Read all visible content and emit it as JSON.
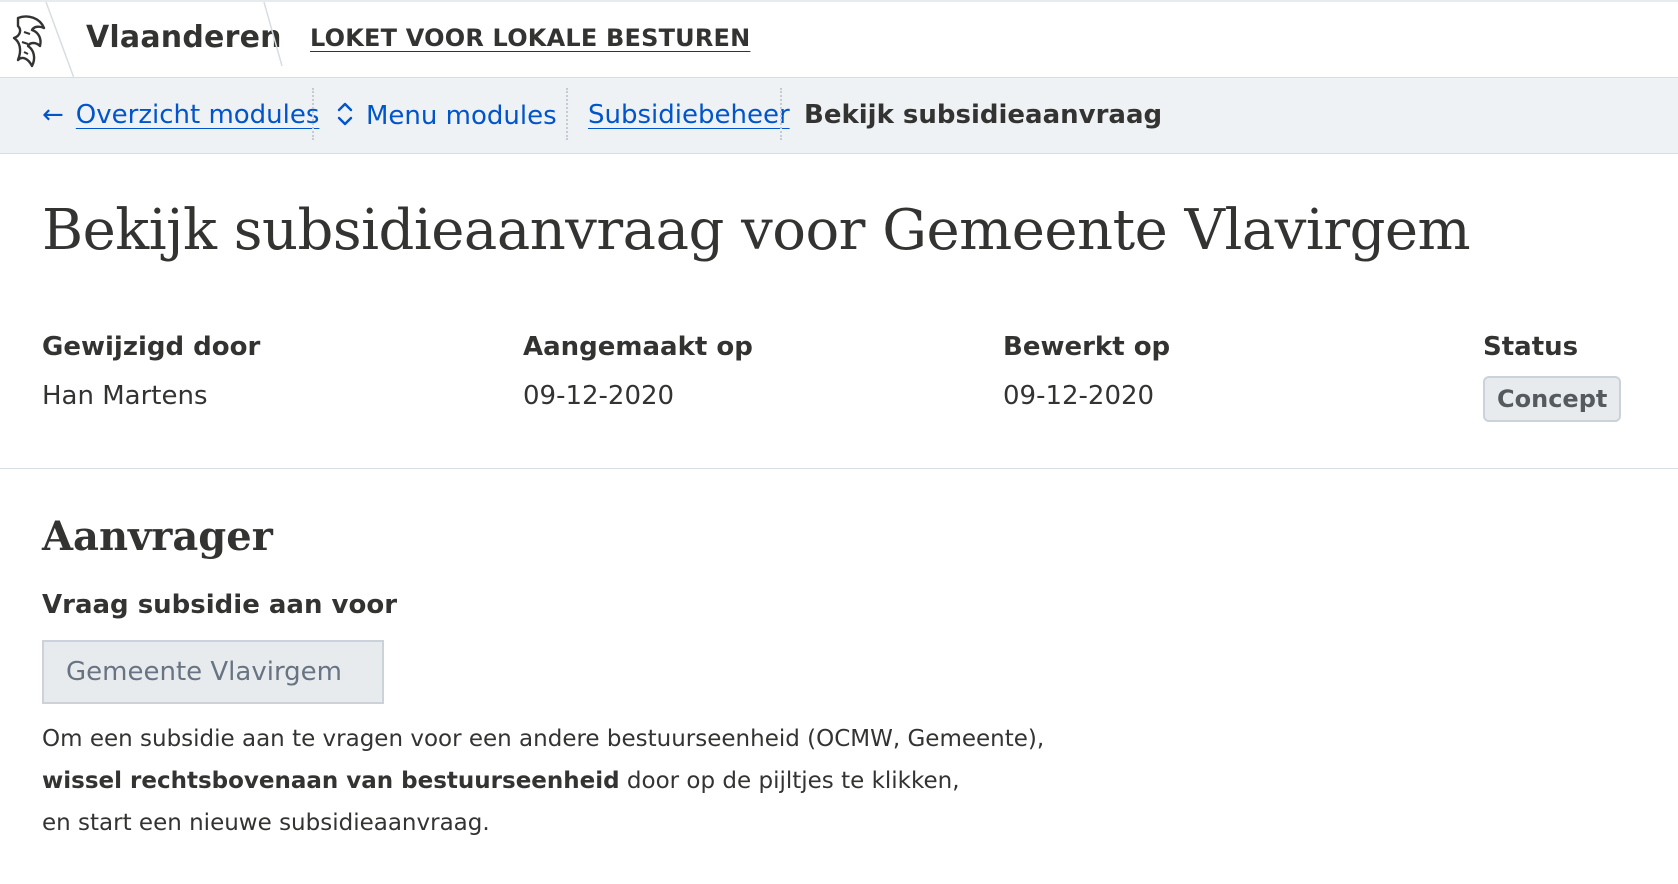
{
  "header": {
    "brand": "Vlaanderen",
    "app_title": "LOKET VOOR LOKALE BESTUREN"
  },
  "breadcrumb": {
    "items": [
      {
        "label": "Overzicht modules",
        "icon": "arrow-left-icon",
        "icon_glyph": "←"
      },
      {
        "label": "Menu modules",
        "icon": "chevron-up-down-icon"
      },
      {
        "label": "Subsidiebeheer"
      },
      {
        "label": "Bekijk subsidieaanvraag"
      }
    ]
  },
  "page": {
    "title": "Bekijk subsidieaanvraag voor Gemeente Vlavirgem"
  },
  "meta": {
    "modified_by": {
      "label": "Gewijzigd door",
      "value": "Han Martens"
    },
    "created_on": {
      "label": "Aangemaakt op",
      "value": "09-12-2020"
    },
    "edited_on": {
      "label": "Bewerkt op",
      "value": "09-12-2020"
    },
    "status": {
      "label": "Status",
      "value": "Concept"
    }
  },
  "section": {
    "title": "Aanvrager",
    "field_label": "Vraag subsidie aan voor",
    "field_value": "Gemeente Vlavirgem",
    "help_line1": "Om een subsidie aan te vragen voor een andere bestuurseenheid (OCMW, Gemeente),",
    "help_line2_bold": "wissel rechtsbovenaan van bestuurseenheid",
    "help_line2_rest": " door op de pijltjes te klikken,",
    "help_line3": "en start een nieuwe subsidieaanvraag."
  },
  "colors": {
    "link": "#0055cc",
    "text": "#333332",
    "bar_background": "#eff2f4",
    "pill_background": "#e8ebee"
  }
}
